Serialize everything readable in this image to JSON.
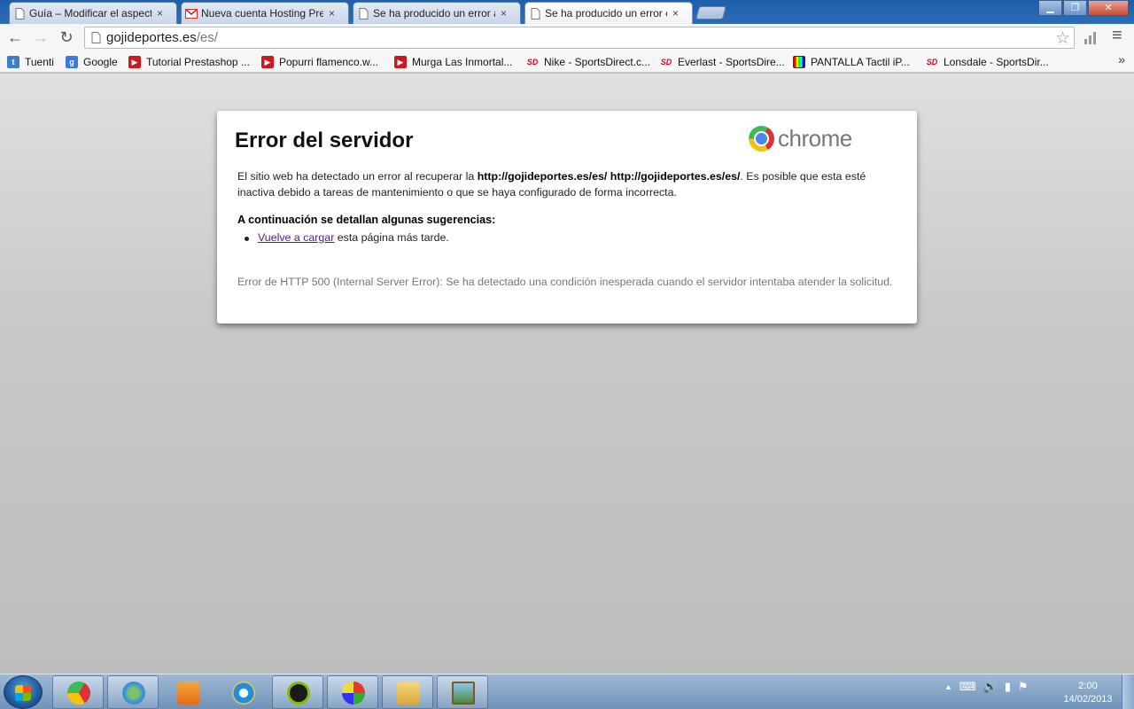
{
  "tabs": [
    {
      "title": "Guía – Modificar el aspect",
      "close": "×"
    },
    {
      "title": "Nueva cuenta Hosting Pre",
      "close": "×"
    },
    {
      "title": "Se ha producido un error a",
      "close": "×"
    },
    {
      "title": "Se ha producido un error c",
      "close": "×"
    }
  ],
  "window_controls": {
    "minimize": "▁",
    "maximize": "❐",
    "close": "✕"
  },
  "toolbar": {
    "back": "←",
    "forward": "→",
    "reload": "↻",
    "url_host": "gojideportes.es",
    "url_path": "/es/",
    "star": "☆",
    "menu": "≡"
  },
  "bookmarks": [
    {
      "label": "Tuenti",
      "icon": "tuenti-icon",
      "color": "#3b7fc4"
    },
    {
      "label": "Google",
      "icon": "google-icon",
      "color": "#3b78e7"
    },
    {
      "label": "Tutorial Prestashop ...",
      "icon": "youtube-icon",
      "color": "#cc181e"
    },
    {
      "label": "Popurri flamenco.w...",
      "icon": "youtube-icon",
      "color": "#cc181e"
    },
    {
      "label": "Murga Las Inmortal...",
      "icon": "youtube-icon",
      "color": "#cc181e"
    },
    {
      "label": "Nike - SportsDirect.c...",
      "icon": "sportsdirect-icon",
      "color": "#e3001b"
    },
    {
      "label": "Everlast - SportsDire...",
      "icon": "sportsdirect-icon",
      "color": "#e3001b"
    },
    {
      "label": "PANTALLA Tactil iP...",
      "icon": "tv-icon",
      "color": "#333333"
    },
    {
      "label": "Lonsdale - SportsDir...",
      "icon": "sportsdirect-icon",
      "color": "#e3001b"
    }
  ],
  "bookmarks_more": "»",
  "error_page": {
    "title": "Error del servidor",
    "logo_word": "chrome",
    "message_prefix": "El sitio web ha detectado un error al recuperar la ",
    "message_url": "http://gojideportes.es/es/ http://gojideportes.es/es/",
    "message_suffix": ". Es posible que esta esté inactiva debido a tareas de mantenimiento o que se haya configurado de forma incorrecta.",
    "suggestions_title": "A continuación se detallan algunas sugerencias:",
    "suggestion_link": "Vuelve a cargar",
    "suggestion_rest": " esta página más tarde.",
    "error_detail": "Error de HTTP 500 (Internal Server Error): Se ha detectado una condición inesperada cuando el servidor intentaba atender la solicitud."
  },
  "taskbar": {
    "apps": [
      "chrome-icon",
      "messenger-icon",
      "media-player-icon",
      "internet-explorer-icon",
      "spotify-icon",
      "paint-icon",
      "file-explorer-icon",
      "photo-viewer-icon"
    ],
    "tray": [
      "▲",
      "⌨",
      "🔊",
      "▮",
      "⚑"
    ],
    "time": "2:00",
    "date": "14/02/2013"
  },
  "colors": {
    "titlebar": "#2c6cb6",
    "link_visited": "#551a8b",
    "error_grey": "#777777"
  }
}
